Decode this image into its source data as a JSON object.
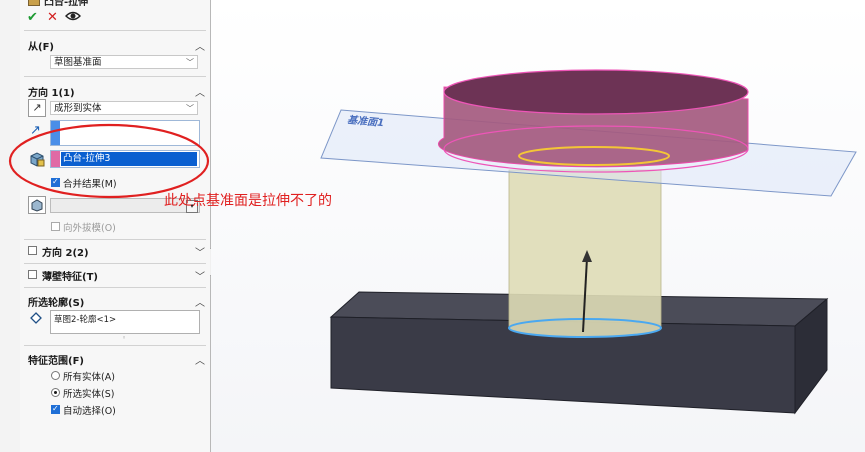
{
  "feature": {
    "title": "凸台-拉伸",
    "confirm_icon": "check-icon",
    "cancel_icon": "close-icon",
    "preview_icon": "eye-icon"
  },
  "from": {
    "header": "从(F)",
    "value": "草图基准面"
  },
  "direction1": {
    "header": "方向 1(1)",
    "end_condition": "成形到实体",
    "direction_value": "",
    "body_value": "凸台-拉伸3",
    "merge_label": "合并结果(M)",
    "merge_checked": true,
    "draft_value": "",
    "draft_label": "向外拔模(O)",
    "draft_checked": false
  },
  "direction2": {
    "header": "方向 2(2)",
    "checked": false
  },
  "thin_feature": {
    "header": "薄壁特征(T)",
    "checked": false
  },
  "selected_contours": {
    "header": "所选轮廓(S)",
    "item": "草图2-轮廓<1>"
  },
  "feature_scope": {
    "header": "特征范围(F)",
    "options": [
      {
        "label": "所有实体(A)",
        "selected": false
      },
      {
        "label": "所选实体(S)",
        "selected": true
      }
    ],
    "auto_select_label": "自动选择(O)",
    "auto_select_checked": true
  },
  "annotation": {
    "text": "此处点基准面是拉伸不了的",
    "color": "#e02020"
  },
  "viewport": {
    "plane_label": "基准面1"
  },
  "colors": {
    "highlight": "#1e6fd9",
    "annotation_ellipse": "#e02020",
    "top_boss": "#a45a7f",
    "cylinder": "#dedcb6",
    "base_block": "#3e3f4b"
  }
}
